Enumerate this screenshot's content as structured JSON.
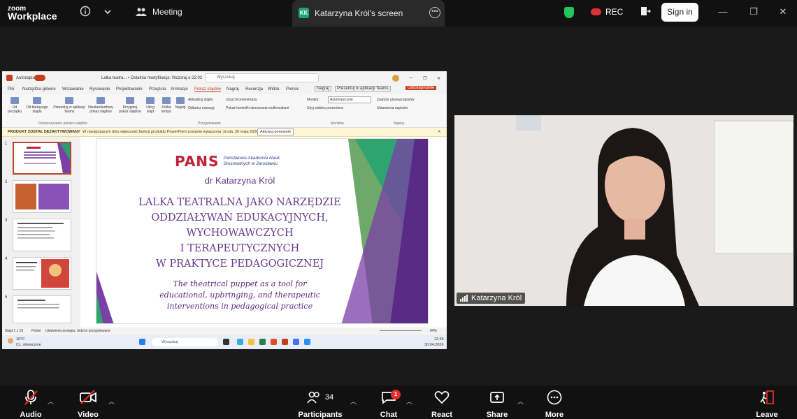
{
  "app": {
    "logo_line1": "zoom",
    "logo_line2": "Workplace",
    "meeting_label": "Meeting"
  },
  "share_tab": {
    "initials": "KK",
    "label": "Katarzyna Król's screen"
  },
  "top_right": {
    "rec_label": "REC",
    "signin_label": "Sign in"
  },
  "powerpoint": {
    "autosave": "Autozapis",
    "doc_title": "Lalka teatra... • Ostatnia modyfikacja: Wczoraj o 22:02",
    "search_placeholder": "Wyszukaj",
    "menu": [
      "Plik",
      "Narzędzia główne",
      "Wstawianie",
      "Rysowanie",
      "Projektowanie",
      "Przejścia",
      "Animacje",
      "Pokaz slajdów",
      "Nagraj",
      "Recenzja",
      "Widok",
      "Pomoc"
    ],
    "menu_right": [
      "Nagraj",
      "Prezentuj w aplikacji Teams",
      "Udostępnianie"
    ],
    "ribbon": {
      "b1": "Od początku",
      "b2": "Od bieżącego slajdu",
      "b3": "Prezentuj w aplikacji Teams",
      "b4": "Niestandardowy pokaz slajdów",
      "b5": "Przygotuj pokaz slajdów",
      "b6": "Ukryj slajd",
      "b7": "Próba tempa",
      "b8": "Nagraj",
      "c1": "Aktualizuj slajdy",
      "c2": "Użyj chronometrażu",
      "c3": "Odtwórz narrację",
      "c4": "Pokaż kontrolki sterowania multimediami",
      "monitor_label": "Monitor:",
      "monitor_value": "Automatycznie",
      "c5": "Użyj widoku prezentera",
      "c6": "Zawsze używaj napisów",
      "c7": "Ustawienia napisów",
      "g1": "Rozpoczynanie pokazu slajdów",
      "g2": "Przygotowanie",
      "g3": "Monitory",
      "g4": "Napisy"
    },
    "notice_bold": "PRODUKT ZOSTAŁ DEZAKTYWOWANY",
    "notice_text": "W następującym dniu większość funkcji produktu PowerPoint zostanie wyłączona: środa, 20 maja 2026.",
    "notice_button": "Aktywuj ponownie",
    "thumb_numbers": [
      "1",
      "2",
      "3",
      "4",
      "5"
    ],
    "status_left": "Slajd 1 z 19",
    "status_lang": "Polski",
    "status_access": "Ułatwienia dostępu: dobrze przygotowane",
    "zoom_pct": "84%"
  },
  "slide": {
    "org_logo": "PANS",
    "org_name": "Państwowa Akademia Nauk Stosowanych w Jarosławiu",
    "author": "dr Katarzyna Król",
    "title_lines": [
      "LALKA TEATRALNA JAKO NARZĘDZIE",
      "ODDZIAŁYWAŃ EDUKACYJNYCH,",
      "WYCHOWAWCZYCH",
      "I TERAPEUTYCZNYCH",
      "W PRAKTYCE PEDAGOGICZNEJ"
    ],
    "subtitle_lines": [
      "The theatrical puppet as a tool for",
      "educational, upbringing, and therapeutic",
      "interventions in pedagogical practice"
    ]
  },
  "taskbar": {
    "weather_temp": "10°C",
    "weather_desc": "Cz. słonecznie",
    "search_label": "Wyszukaj",
    "time": "12:34",
    "date": "30.04.2026"
  },
  "video": {
    "participant_name": "Katarzyna Król"
  },
  "bottom": {
    "audio": "Audio",
    "video": "Video",
    "participants": "Participants",
    "participants_count": "34",
    "chat": "Chat",
    "chat_badge": "1",
    "react": "React",
    "share": "Share",
    "more": "More",
    "leave": "Leave"
  }
}
